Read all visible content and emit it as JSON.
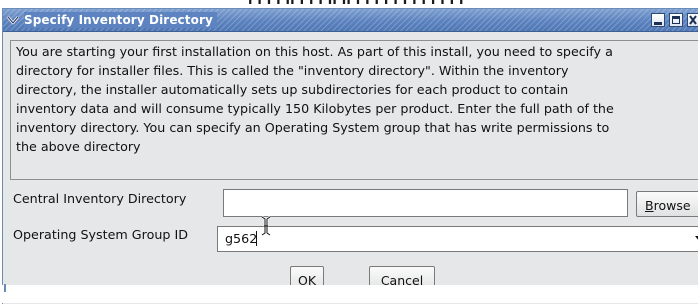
{
  "dialog": {
    "title": "Specify Inventory Directory",
    "description": "You are starting your first installation on this host. As part of this install, you need to specify a\ndirectory for installer files. This is called the \"inventory directory\". Within the inventory\ndirectory, the installer automatically sets up subdirectories for each product to contain\ninventory data and will consume typically 150 Kilobytes per product. Enter the full path of the\ninventory directory. You can specify an Operating System group that has write permissions to\nthe above directory",
    "inventory_label": "Central Inventory Directory",
    "inventory_value": "",
    "browse": {
      "mnemonic": "B",
      "rest": "rowse"
    },
    "group_label": "Operating System Group ID",
    "group_value": "g562",
    "ok": {
      "prefix": "O",
      "mnemonic": "K"
    },
    "cancel": {
      "mnemonic": "C",
      "rest": "ancel"
    }
  },
  "backdrop": {
    "partial_text": "ı ı ı ı ıı ı ı ı ıı ıı ı ı ı ı ı ı ı ı ı ı ı ı"
  },
  "colors": {
    "titlebar": "#5d84c0",
    "dialog_bg": "#e6e7e8",
    "border": "#7a7a7a"
  },
  "icons": {
    "menu": "chevron-down-icon",
    "minimize": "minimize-icon",
    "maximize": "maximize-icon",
    "close": "close-icon",
    "cursor": "i-beam-icon"
  }
}
